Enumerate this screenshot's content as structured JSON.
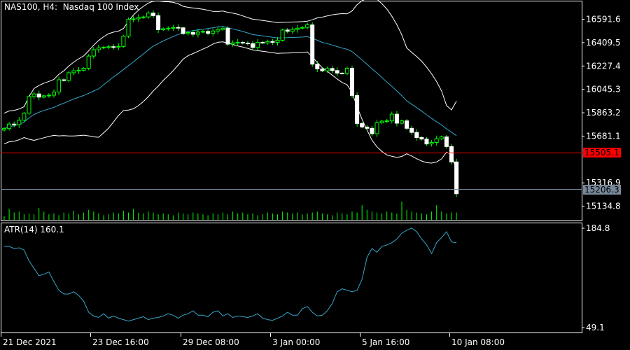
{
  "header": {
    "symbol": "NAS100, H4:",
    "description": "Nasdaq 100 Index"
  },
  "indicator": {
    "name": "ATR(14)",
    "value": "160.1"
  },
  "colors": {
    "background": "#000000",
    "axis": "#ffffff",
    "bull_candle": "#ffffff",
    "candle_wick": "#00ff00",
    "bollinger": "#ffffff",
    "moving_average": "#37a5c8",
    "volume": "#00ff00",
    "atr_line": "#37a5c8",
    "bid_line": "#ff0000",
    "ask_line": "#778899"
  },
  "price_tags": {
    "bid": "15505.1",
    "ask": "15206.3"
  },
  "chart_data": [
    {
      "type": "candlestick",
      "title": "NAS100, H4:  Nasdaq 100 Index",
      "ylim": [
        15040,
        16720
      ],
      "y_ticks": [
        "16591.6",
        "16409.5",
        "16227.4",
        "16045.3",
        "15863.2",
        "15681.1",
        "15316.9",
        "15134.8"
      ],
      "x_ticks": [
        "21 Dec 2021",
        "23 Dec 16:00",
        "29 Dec 08:00",
        "3 Jan 00:00",
        "5 Jan 16:00",
        "10 Jan 08:00"
      ],
      "bid_price": 15505.1,
      "ask_price": 15206.3,
      "closes": [
        15740,
        15775,
        15770,
        15805,
        15860,
        15990,
        16010,
        15985,
        15995,
        16000,
        16025,
        16120,
        16115,
        16175,
        16190,
        16195,
        16210,
        16305,
        16355,
        16368,
        16374,
        16378,
        16376,
        16380,
        16460,
        16590,
        16595,
        16605,
        16610,
        16640,
        16620,
        16510,
        16518,
        16522,
        16528,
        16525,
        16480,
        16488,
        16475,
        16492,
        16497,
        16482,
        16500,
        16512,
        16522,
        16398,
        16408,
        16412,
        16406,
        16402,
        16372,
        16412,
        16408,
        16418,
        16412,
        16428,
        16508,
        16498,
        16512,
        16522,
        16528,
        16548,
        16242,
        16205,
        16190,
        16208,
        16192,
        16172,
        16170,
        16210,
        15998,
        15780,
        15752,
        15742,
        15700,
        15785,
        15798,
        15800,
        15852,
        15782,
        15800,
        15742,
        15710,
        15670,
        15658,
        15620,
        15632,
        15660,
        15675,
        15600,
        15480,
        15232
      ],
      "volume_scale": [
        0,
        100
      ],
      "volumes": [
        20,
        60,
        40,
        45,
        30,
        35,
        30,
        65,
        45,
        30,
        35,
        25,
        40,
        35,
        50,
        30,
        40,
        55,
        45,
        35,
        25,
        30,
        40,
        35,
        50,
        40,
        60,
        40,
        35,
        45,
        40,
        30,
        35,
        30,
        25,
        40,
        35,
        30,
        40,
        35,
        30,
        25,
        35,
        30,
        40,
        30,
        45,
        35,
        40,
        30,
        35,
        25,
        30,
        40,
        35,
        30,
        45,
        40,
        35,
        40,
        30,
        35,
        40,
        45,
        35,
        30,
        25,
        40,
        35,
        30,
        45,
        40,
        80,
        55,
        45,
        40,
        35,
        45,
        40,
        35,
        100,
        55,
        45,
        40,
        35,
        30,
        45,
        80,
        45,
        35,
        40,
        40
      ]
    },
    {
      "type": "line",
      "title": "ATR(14) 160.1",
      "ylim": [
        49.1,
        184.8
      ],
      "y_ticks": [
        "184.8",
        "49.1"
      ],
      "values": [
        160,
        160,
        157,
        158,
        155,
        140,
        130,
        120,
        122,
        125,
        112,
        100,
        95,
        95,
        98,
        93,
        85,
        70,
        65,
        63,
        68,
        62,
        65,
        62,
        60,
        58,
        60,
        62,
        64,
        60,
        62,
        63,
        65,
        68,
        66,
        62,
        66,
        68,
        72,
        66,
        66,
        64,
        70,
        72,
        65,
        68,
        63,
        65,
        64,
        63,
        65,
        68,
        62,
        60,
        59,
        62,
        65,
        70,
        66,
        66,
        75,
        78,
        70,
        65,
        66,
        72,
        82,
        98,
        102,
        100,
        98,
        100,
        115,
        145,
        157,
        152,
        160,
        162,
        165,
        170,
        178,
        182,
        185,
        180,
        170,
        162,
        150,
        165,
        172,
        180,
        166,
        165
      ]
    }
  ]
}
